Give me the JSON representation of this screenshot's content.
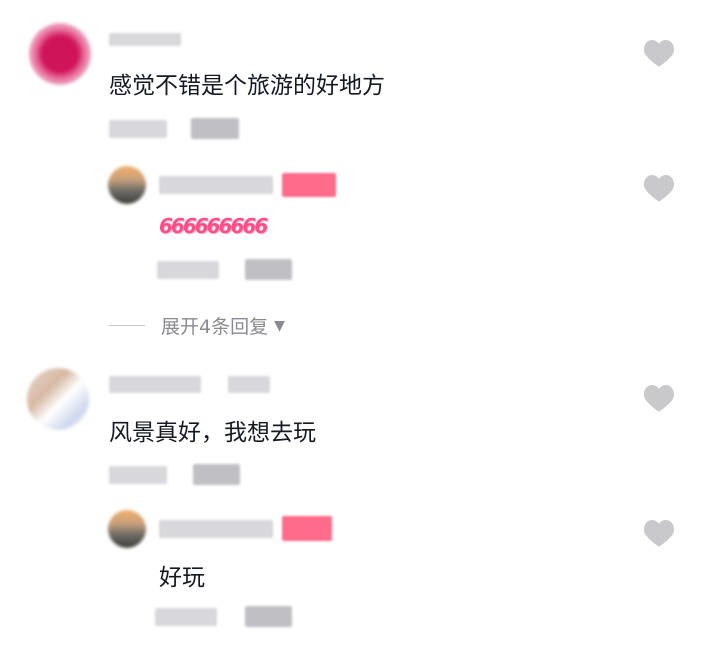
{
  "comments": [
    {
      "text": "感觉不错是个旅游的好地方",
      "reply": {
        "text": "666666666"
      },
      "expand_label": "展开4条回复"
    },
    {
      "text": "风景真好，我想去玩",
      "reply": {
        "text": "好玩"
      }
    }
  ],
  "icons": {
    "like": "heart-icon",
    "expand": "caret-down-icon"
  },
  "colors": {
    "heart": "#c9c9cc",
    "author_tag": "#ff6b8a",
    "muted_text": "#8a8b91"
  }
}
